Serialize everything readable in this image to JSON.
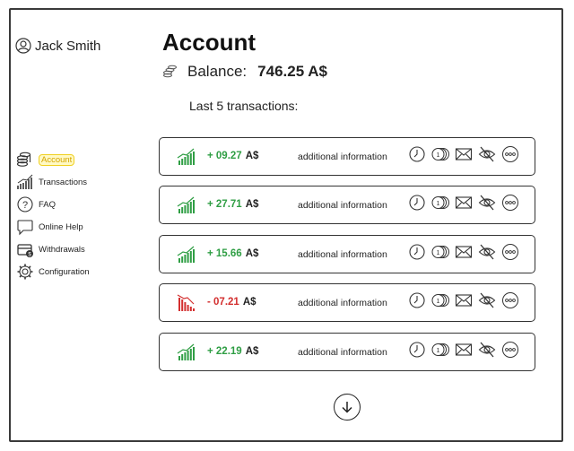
{
  "user": {
    "name": "Jack Smith"
  },
  "nav": [
    {
      "label": "Account",
      "icon": "coins-icon",
      "active": true
    },
    {
      "label": "Transactions",
      "icon": "bar-chart-icon",
      "active": false
    },
    {
      "label": "FAQ",
      "icon": "help-icon",
      "active": false
    },
    {
      "label": "Online Help",
      "icon": "chat-bubble-icon",
      "active": false
    },
    {
      "label": "Withdrawals",
      "icon": "wallet-icon",
      "active": false
    },
    {
      "label": "Configuration",
      "icon": "gear-icon",
      "active": false
    }
  ],
  "main": {
    "title": "Account",
    "balance_label": "Balance:",
    "balance_value": "746.25 A$",
    "last_label": "Last 5 transactions:"
  },
  "transactions": [
    {
      "amount": "+ 09.27",
      "currency": "A$",
      "info": "additional information",
      "direction": "up"
    },
    {
      "amount": "+ 27.71",
      "currency": "A$",
      "info": "additional information",
      "direction": "up"
    },
    {
      "amount": "+ 15.66",
      "currency": "A$",
      "info": "additional information",
      "direction": "up"
    },
    {
      "amount": "- 07.21",
      "currency": "A$",
      "info": "additional information",
      "direction": "down"
    },
    {
      "amount": "+ 22.19",
      "currency": "A$",
      "info": "additional information",
      "direction": "up"
    }
  ],
  "transaction_actions": [
    "clock-icon",
    "coins-icon",
    "envelope-icon",
    "hide-icon",
    "more-icon"
  ],
  "colors": {
    "positive": "#2f9e44",
    "negative": "#d32f2f",
    "active_highlight": "#f0d020"
  }
}
